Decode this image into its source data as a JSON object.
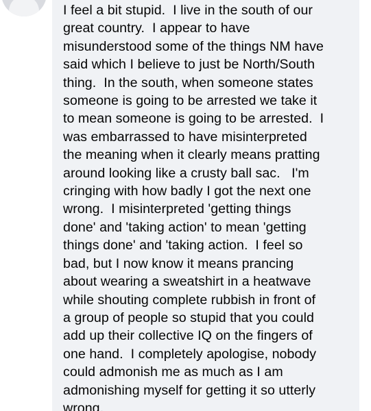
{
  "comment": {
    "lines": [
      "I feel a bit stupid.  I live in the south of our",
      "great country.  I appear to have",
      "misunderstood some of the things NM have",
      "said which I believe to just be North/South",
      "thing.  In the south, when someone states",
      "someone is going to be arrested we take it",
      "to mean someone is going to be arrested.  I",
      "was embarrassed to have misinterpreted",
      "the meaning when it clearly means pratting",
      "around looking like a crusty ball sac.   I'm",
      "cringing with how badly I got the next one",
      "wrong.  I misinterpreted 'getting things",
      "done' and 'taking action' to mean 'getting",
      "things done' and 'taking action.  I feel so",
      "bad, but I now know it means prancing",
      "about wearing a sweatshirt in a heatwave",
      "while shouting complete rubbish in front of",
      "a group of people so stupid that you could",
      "add up their collective IQ on the fingers of",
      "one hand.  I completely apologise, nobody",
      "could admonish me as much as I am",
      "admonishing myself for getting it so utterly",
      "wrong."
    ]
  },
  "colors": {
    "bubble_background": "#f0f2f5",
    "text": "#050505",
    "avatar_placeholder": "#d9dbe0"
  },
  "icons": {
    "avatar": "default-profile-avatar-icon"
  }
}
